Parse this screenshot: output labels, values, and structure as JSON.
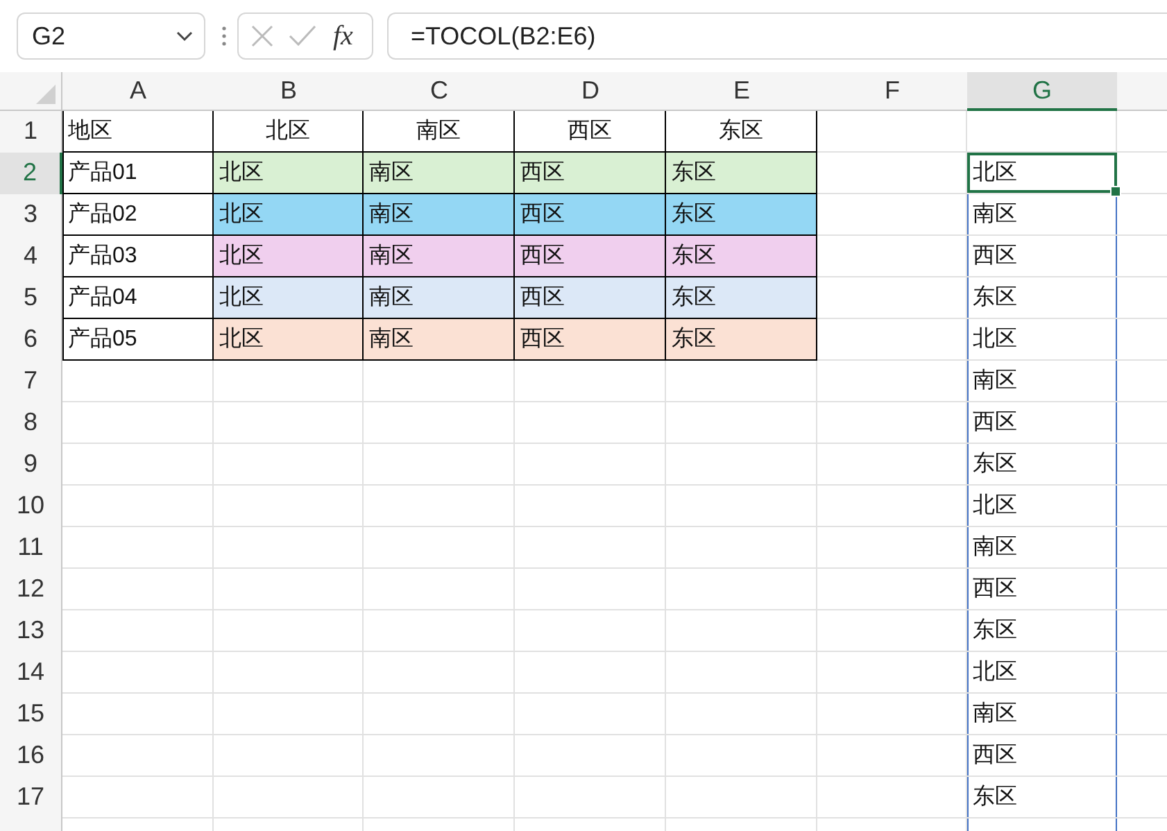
{
  "name_box": {
    "value": "G2"
  },
  "formula_bar": {
    "function_label": "fx",
    "formula": "=TOCOL(B2:E6)"
  },
  "columns": [
    {
      "label": "A",
      "selected": false
    },
    {
      "label": "B",
      "selected": false
    },
    {
      "label": "C",
      "selected": false
    },
    {
      "label": "D",
      "selected": false
    },
    {
      "label": "E",
      "selected": false
    },
    {
      "label": "F",
      "selected": false
    },
    {
      "label": "G",
      "selected": true
    }
  ],
  "rows": [
    {
      "number": "1",
      "selected": false,
      "kind": "header",
      "label": "地区",
      "values": [
        "北区",
        "南区",
        "西区",
        "东区"
      ]
    },
    {
      "number": "2",
      "selected": true,
      "kind": "data",
      "label": "产品01",
      "values": [
        "北区",
        "南区",
        "西区",
        "东区"
      ],
      "color": "#d9f0d3",
      "result": {
        "text": "北区",
        "selected": true
      }
    },
    {
      "number": "3",
      "selected": false,
      "kind": "data",
      "label": "产品02",
      "values": [
        "北区",
        "南区",
        "西区",
        "东区"
      ],
      "color": "#94d7f4",
      "result": {
        "text": "南区",
        "selected": false
      }
    },
    {
      "number": "4",
      "selected": false,
      "kind": "data",
      "label": "产品03",
      "values": [
        "北区",
        "南区",
        "西区",
        "东区"
      ],
      "color": "#f0cfee",
      "result": {
        "text": "西区",
        "selected": false
      }
    },
    {
      "number": "5",
      "selected": false,
      "kind": "data",
      "label": "产品04",
      "values": [
        "北区",
        "南区",
        "西区",
        "东区"
      ],
      "color": "#dce8f7",
      "result": {
        "text": "东区",
        "selected": false
      }
    },
    {
      "number": "6",
      "selected": false,
      "kind": "data",
      "label": "产品05",
      "values": [
        "北区",
        "南区",
        "西区",
        "东区"
      ],
      "color": "#fbe1d4",
      "result": {
        "text": "北区",
        "selected": false
      }
    },
    {
      "number": "7",
      "selected": false,
      "kind": "blank",
      "result": {
        "text": "南区",
        "selected": false
      }
    },
    {
      "number": "8",
      "selected": false,
      "kind": "blank",
      "result": {
        "text": "西区",
        "selected": false
      }
    },
    {
      "number": "9",
      "selected": false,
      "kind": "blank",
      "result": {
        "text": "东区",
        "selected": false
      }
    },
    {
      "number": "10",
      "selected": false,
      "kind": "blank",
      "result": {
        "text": "北区",
        "selected": false
      }
    },
    {
      "number": "11",
      "selected": false,
      "kind": "blank",
      "result": {
        "text": "南区",
        "selected": false
      }
    },
    {
      "number": "12",
      "selected": false,
      "kind": "blank",
      "result": {
        "text": "西区",
        "selected": false
      }
    },
    {
      "number": "13",
      "selected": false,
      "kind": "blank",
      "result": {
        "text": "东区",
        "selected": false
      }
    },
    {
      "number": "14",
      "selected": false,
      "kind": "blank",
      "result": {
        "text": "北区",
        "selected": false
      }
    },
    {
      "number": "15",
      "selected": false,
      "kind": "blank",
      "result": {
        "text": "南区",
        "selected": false
      }
    },
    {
      "number": "16",
      "selected": false,
      "kind": "blank",
      "result": {
        "text": "西区",
        "selected": false
      }
    },
    {
      "number": "17",
      "selected": false,
      "kind": "blank",
      "result": {
        "text": "东区",
        "selected": false
      }
    }
  ]
}
